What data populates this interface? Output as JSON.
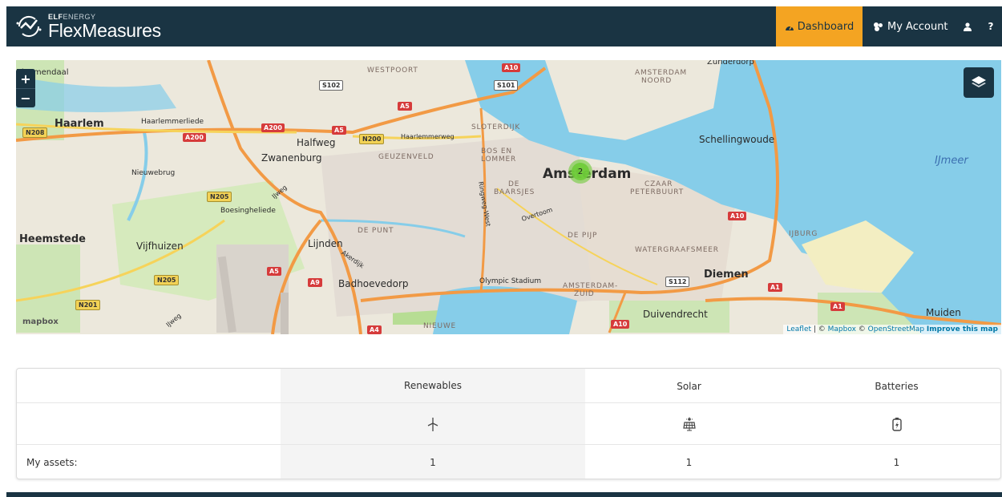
{
  "navbar": {
    "brand_company_prefix": "ELF",
    "brand_company_suffix": "ENERGY",
    "brand_product": "FlexMeasures",
    "dashboard_label": "Dashboard",
    "account_label": "My Account",
    "help_label": "?",
    "active_color": "#f4a422",
    "background_color": "#1a3443"
  },
  "map": {
    "zoom_in": "+",
    "zoom_out": "−",
    "cluster_count": "2",
    "mapbox_logo": "mapbox",
    "attribution": {
      "leaflet": "Leaflet",
      "sep1": " | © ",
      "mapbox": "Mapbox",
      "sep2": " © ",
      "osm": "OpenStreetMap",
      "improve": "Improve this map"
    },
    "labels": {
      "amsterdam": "Amsterdam",
      "haarlem": "Haarlem",
      "heemstede": "Heemstede",
      "diemen": "Diemen",
      "zwanenburg": "Zwanenburg",
      "badhoevedorp": "Badhoevedorp",
      "halfweg": "Halfweg",
      "schellingwoude": "Schellingwoude",
      "ijmeer": "IJmeer",
      "duivendrecht": "Duivendrecht",
      "muiden": "Muiden",
      "vijfhuizen": "Vijfhuizen",
      "lijnden": "Lijnden",
      "boesingheliede": "Boesingheliede",
      "nieuwebrug": "Nieuwebrug",
      "haarlemmerliede": "Haarlemmerliede",
      "bloemendaal": "Bloemendaal",
      "zunderdorp": "Zunderdorp",
      "westpoort": "WESTPOORT",
      "amsterdam_noord_1": "AMSTERDAM",
      "amsterdam_noord_2": "NOORD",
      "sloterdijk": "SLOTERDIJK",
      "bos_en_lommer_1": "BOS EN",
      "bos_en_lommer_2": "LOMMER",
      "geuzenveld": "GEUZENVELD",
      "de_baarsjes_1": "DE",
      "de_baarsjes_2": "BAARSJES",
      "czaar_1": "CZAAR",
      "czaar_2": "PETERBUURT",
      "de_punt": "DE PUNT",
      "de_pijp": "DE PIJP",
      "ijburg": "IJBURG",
      "watergraafsmeer": "WATERGRAAFSMEER",
      "amsterdam_zuid_1": "AMSTERDAM-",
      "amsterdam_zuid_2": "ZUID",
      "nieuwe_meer": "NIEUWE",
      "olympic_stadium": "Olympic Stadium",
      "overtoom": "Overtoom",
      "ringweg_west": "Ringweg-West",
      "haarlemmerweg": "Haarlemmerweg",
      "akerdijk": "Akerdijk",
      "ijweg_1": "IJweg",
      "ijweg_2": "IJweg",
      "spaarnwoude": "N208"
    },
    "shields": {
      "a10_top": "A10",
      "s102": "S102",
      "s101": "S101",
      "a5_top": "A5",
      "a200_1": "A200",
      "a200_2": "A200",
      "a5_mid": "A5",
      "n200": "N200",
      "n208": "N208",
      "n205_1": "N205",
      "n205_2": "N205",
      "n201": "N201",
      "a5_low": "A5",
      "a9": "A9",
      "a4": "A4",
      "a10_right": "A10",
      "s112": "S112",
      "a1_1": "A1",
      "a1_2": "A1",
      "a10_bottom": "A10"
    }
  },
  "assets_table": {
    "columns": [
      "Renewables",
      "Solar",
      "Batteries"
    ],
    "icons": [
      "wind-turbine-icon",
      "solar-panel-icon",
      "battery-icon"
    ],
    "row_label": "My assets:",
    "values": [
      "1",
      "1",
      "1"
    ]
  }
}
